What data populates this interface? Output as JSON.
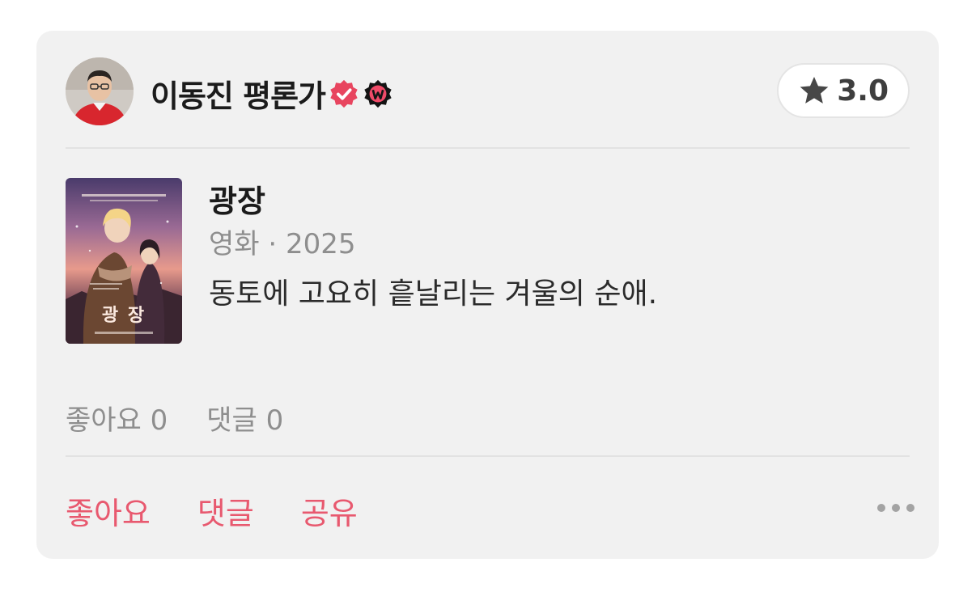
{
  "author": {
    "name": "이동진 평론가",
    "avatar_icon": "avatar-photo",
    "badges": [
      "verified-badge-icon",
      "watcha-w-badge-icon"
    ]
  },
  "rating": {
    "icon": "star-icon",
    "value": "3.0"
  },
  "content": {
    "poster_icon": "movie-poster",
    "poster_title": "광 장",
    "title": "광장",
    "meta": "영화 · 2025",
    "review": "동토에 고요히 흩날리는 겨울의 순애."
  },
  "stats": {
    "likes": "좋아요 0",
    "comments": "댓글 0"
  },
  "actions": {
    "like": "좋아요",
    "comment": "댓글",
    "share": "공유",
    "more_icon": "more-icon"
  },
  "colors": {
    "card_bg": "#f1f1f1",
    "accent": "#e8596f",
    "muted": "#8e8e8e"
  }
}
